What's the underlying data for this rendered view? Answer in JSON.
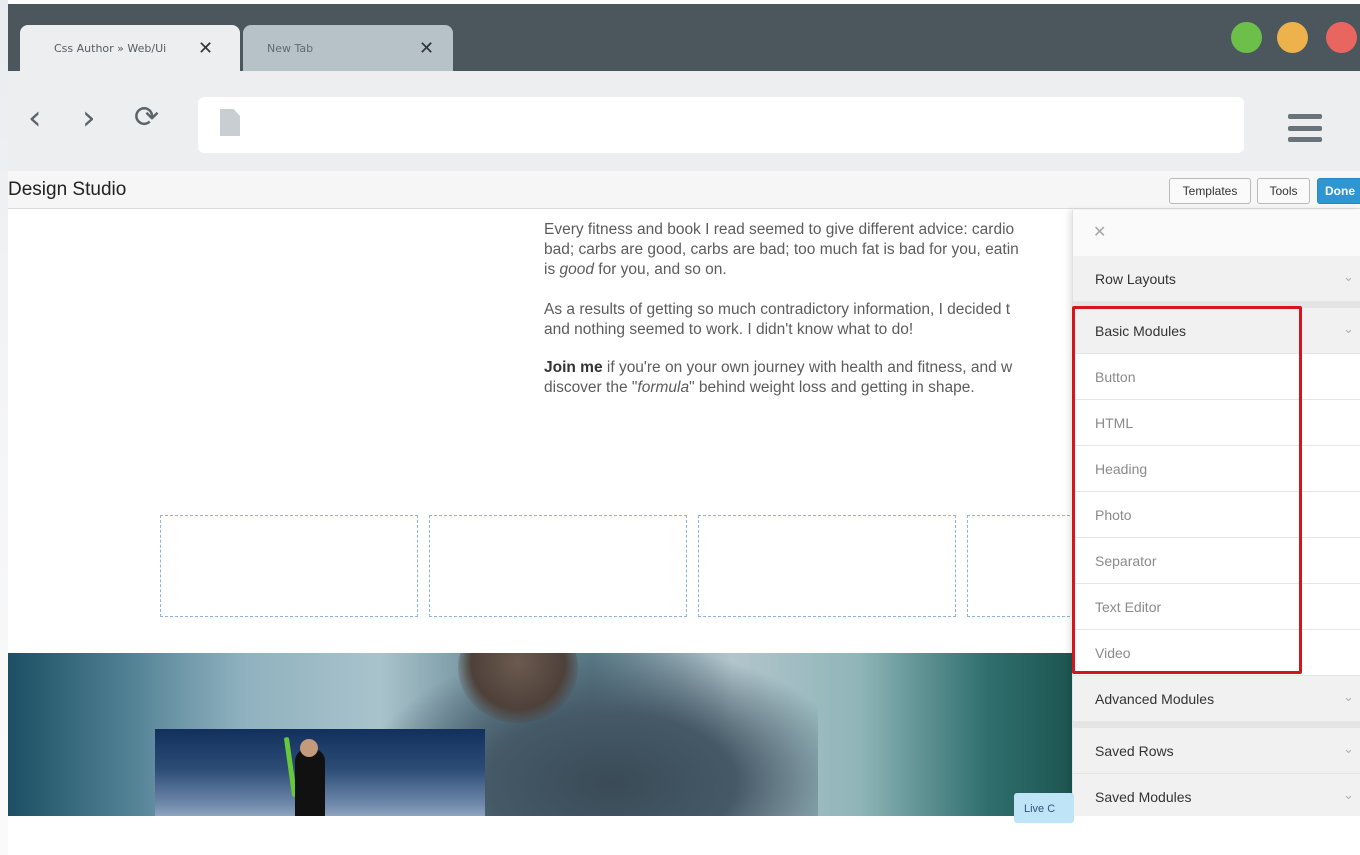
{
  "tabs": [
    {
      "title": "Css Author » Web/Ui",
      "close": "✕"
    },
    {
      "title": "New Tab",
      "close": "✕"
    }
  ],
  "toolbar": {
    "back_icon": "‹",
    "forward_icon": "›",
    "reload_icon": "⟳"
  },
  "studio": {
    "title": "Design Studio",
    "templates_label": "Templates",
    "tools_label": "Tools",
    "done_label": "Done"
  },
  "content": {
    "para1_line1": "Every fitness and book I read seemed to give different advice: cardio",
    "para1_line2": "bad; carbs are good, carbs are bad; too much fat is bad for you, eatin",
    "para1_line3_a": "is ",
    "para1_line3_em": "good",
    "para1_line3_b": " for you, and so on.",
    "para2_line1": "As a results  of getting so much contradictory information, I decided t",
    "para2_line2": "and nothing seemed to work. I didn't know what to do!",
    "para3_bold": "Join me",
    "para3_line1": " if you're on your own journey with health and fitness, and w",
    "para3_line2_a": "discover the \"",
    "para3_line2_em": "formula",
    "para3_line2_b": "\" behind weight loss and getting in shape.",
    "live_chip": "Live C"
  },
  "panel": {
    "close": "✕",
    "chevron": "⌄",
    "row_layouts": "Row Layouts",
    "basic_modules": "Basic Modules",
    "basic_items": [
      "Button",
      "HTML",
      "Heading",
      "Photo",
      "Separator",
      "Text Editor",
      "Video"
    ],
    "advanced_modules": "Advanced Modules",
    "saved_rows": "Saved Rows",
    "saved_modules": "Saved Modules"
  },
  "colors": {
    "titlebar": "#4b565d",
    "done_button": "#2f96d4",
    "highlight": "#d6141b",
    "win_green": "#6cc04a",
    "win_yellow": "#eeb24c",
    "win_red": "#e8665f"
  }
}
